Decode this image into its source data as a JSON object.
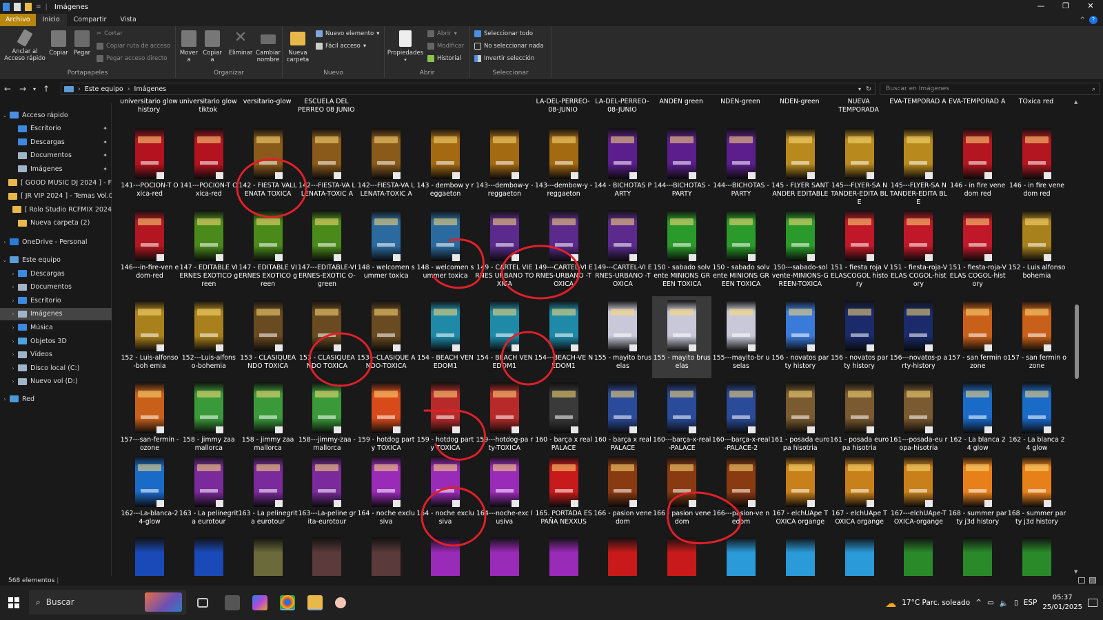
{
  "window": {
    "title": "Imágenes"
  },
  "menu_tabs": [
    "Archivo",
    "Inicio",
    "Compartir",
    "Vista"
  ],
  "ribbon": {
    "portapapeles": {
      "label": "Portapapeles",
      "pin": "Anclar al Acceso rápido",
      "copy": "Copiar",
      "paste": "Pegar",
      "cut": "Cortar",
      "copy_path": "Copiar ruta de acceso",
      "paste_shortcut": "Pegar acceso directo"
    },
    "organizar": {
      "label": "Organizar",
      "move": "Mover a",
      "copy_to": "Copiar a",
      "delete": "Eliminar",
      "rename": "Cambiar nombre"
    },
    "nuevo": {
      "label": "Nuevo",
      "new_folder": "Nueva carpeta",
      "new_item": "Nuevo elemento",
      "easy_access": "Fácil acceso"
    },
    "abrir": {
      "label": "Abrir",
      "properties": "Propiedades",
      "open": "Abrir",
      "edit": "Modificar",
      "history": "Historial"
    },
    "seleccionar": {
      "label": "Seleccionar",
      "select_all": "Seleccionar todo",
      "select_none": "No seleccionar nada",
      "invert": "Invertir selección"
    }
  },
  "address": {
    "root": "Este equipo",
    "sep": "›",
    "current": "Imágenes",
    "search_placeholder": "Buscar en Imágenes"
  },
  "nav": {
    "quick_access": "Acceso rápido",
    "quick_items": [
      {
        "label": "Escritorio",
        "icon": "desktop-icon",
        "color": "#3c8ae0",
        "pinned": true
      },
      {
        "label": "Descargas",
        "icon": "downloads-icon",
        "color": "#3c8ae0",
        "pinned": true
      },
      {
        "label": "Documentos",
        "icon": "documents-icon",
        "color": "#9fb4c8",
        "pinned": true
      },
      {
        "label": "Imágenes",
        "icon": "pictures-icon",
        "color": "#9fb4c8",
        "pinned": true
      },
      {
        "label": "[ GOOD MUSIC DJ 2024 ] - F",
        "icon": "folder-icon",
        "color": "#e8b84a",
        "pinned": false
      },
      {
        "label": "[ JR VIP 2024 ] - Temas Vol.0",
        "icon": "folder-icon",
        "color": "#e8b84a",
        "pinned": false
      },
      {
        "label": "[ Rolo Studio RCFMIX 2024",
        "icon": "folder-icon",
        "color": "#e8b84a",
        "pinned": false
      },
      {
        "label": "Nueva carpeta (2)",
        "icon": "folder-icon",
        "color": "#e8b84a",
        "pinned": false
      }
    ],
    "onedrive": "OneDrive - Personal",
    "this_pc": "Este equipo",
    "pc_items": [
      {
        "label": "Descargas",
        "icon": "downloads-icon",
        "color": "#3c8ae0"
      },
      {
        "label": "Documentos",
        "icon": "documents-icon",
        "color": "#9fb4c8"
      },
      {
        "label": "Escritorio",
        "icon": "desktop-icon",
        "color": "#3c8ae0"
      },
      {
        "label": "Imágenes",
        "icon": "pictures-icon",
        "color": "#9fb4c8"
      },
      {
        "label": "Música",
        "icon": "music-icon",
        "color": "#3c8ae0"
      },
      {
        "label": "Objetos 3D",
        "icon": "3d-objects-icon",
        "color": "#4aa3df"
      },
      {
        "label": "Vídeos",
        "icon": "videos-icon",
        "color": "#9fb4c8"
      },
      {
        "label": "Disco local (C:)",
        "icon": "drive-icon",
        "color": "#9fb4c8"
      },
      {
        "label": "Nuevo vol (D:)",
        "icon": "drive-icon",
        "color": "#9fb4c8"
      }
    ],
    "network": "Red"
  },
  "top_partial_names": [
    "universitario glow history",
    "universitario glow tiktok",
    "versitario-glow",
    "ESCUELA DEL PERREO 08 JUNIO",
    "",
    "",
    "",
    "LA-DEL-PERREO-08-JUNIO",
    "LA-DEL-PERREO-08-JUNIO",
    "ANDEN green",
    "NDEN-green",
    "NDEN-green",
    "NUEVA TEMPORADA",
    "EVA-TEMPORAD A",
    "EVA-TEMPORAD A",
    "TOxica red"
  ],
  "rows": [
    {
      "files": [
        {
          "name": "141---POCION-T Oxica-red",
          "color": "#b3121f"
        },
        {
          "name": "141---POCION-T Oxica-red",
          "color": "#b3121f"
        },
        {
          "name": "142 - FIESTA VALLENATA TOXICA",
          "color": "#8a5a1a"
        },
        {
          "name": "142---FIESTA-VA LLENATA-TOXIC A",
          "color": "#8a5a1a"
        },
        {
          "name": "142---FIESTA-VA LLENATA-TOXIC A",
          "color": "#8a5a1a"
        },
        {
          "name": "143 - dembow y reggaeton",
          "color": "#a36a12"
        },
        {
          "name": "143---dembow-y -reggaeton",
          "color": "#a36a12"
        },
        {
          "name": "143---dembow-y -reggaeton",
          "color": "#a36a12"
        },
        {
          "name": "144 - BICHOTAS PARTY",
          "color": "#5b1e8c"
        },
        {
          "name": "144---BICHOTAS -PARTY",
          "color": "#5b1e8c"
        },
        {
          "name": "144---BICHOTAS -PARTY",
          "color": "#5b1e8c"
        },
        {
          "name": "145 - FLYER SANTANDER EDITABLE",
          "color": "#b88a1e"
        },
        {
          "name": "145---FLYER-SA NTANDER-EDITA BLE",
          "color": "#b88a1e"
        },
        {
          "name": "145---FLYER-SA NTANDER-EDITA BLE",
          "color": "#b88a1e"
        },
        {
          "name": "146 - in fire venedom red",
          "color": "#b31620"
        },
        {
          "name": "146 - in fire venedom red",
          "color": "#b31620"
        }
      ]
    },
    {
      "files": [
        {
          "name": "146---in-fire-ven edom-red",
          "color": "#b31620"
        },
        {
          "name": "147 - EDITABLE VIERNES EXOTICO green",
          "color": "#4a8a1a"
        },
        {
          "name": "147 - EDITABLE VIERNES EXOTICO green",
          "color": "#4a8a1a"
        },
        {
          "name": "147---EDITABLE-VIERNES-EXOTIC O-green",
          "color": "#4a8a1a"
        },
        {
          "name": "148 - welcomen summer toxica",
          "color": "#2b6a9e"
        },
        {
          "name": "148 - welcomen summer toxica",
          "color": "#2b6a9e"
        },
        {
          "name": "149 - CARTEL VIERNES URBANO TOXICA",
          "color": "#5b2a8c"
        },
        {
          "name": "149---CARTEL-VI ERNES-URBANO -TOXICA",
          "color": "#5b2a8c"
        },
        {
          "name": "149---CARTEL-VI ERNES-URBANO -TOXICA",
          "color": "#5b2a8c"
        },
        {
          "name": "150 - sabado solvente MINIONS GREEN TOXICA",
          "color": "#2a9a2a"
        },
        {
          "name": "150 - sabado solvente MINIONS GREEN TOXICA",
          "color": "#2a9a2a"
        },
        {
          "name": "150---sabado-sol vente-MINIONS-GREEN-TOXICA",
          "color": "#2a9a2a"
        },
        {
          "name": "151 - fiesta roja VELASCOGOL history",
          "color": "#c01828"
        },
        {
          "name": "151 - fiesta-roja-VELAS COGOL-history",
          "color": "#c01828"
        },
        {
          "name": "151 - fiesta-roja-VELAS COGOL-history",
          "color": "#c01828"
        },
        {
          "name": "152 - Luis alfonso bohemia",
          "color": "#a8801c"
        }
      ]
    },
    {
      "files": [
        {
          "name": "152 - Luis-alfonso-boh emia",
          "color": "#a8801c"
        },
        {
          "name": "152---Luis-alfons o-bohemia",
          "color": "#a8801c"
        },
        {
          "name": "153 - CLASIQUEANDO TOXICA",
          "color": "#6a4a20"
        },
        {
          "name": "153 - CLASIQUEANDO TOXICA",
          "color": "#6a4a20"
        },
        {
          "name": "153---CLASIQUE ANDO-TOXICA",
          "color": "#6a4a20"
        },
        {
          "name": "154 - BEACH VENEDOM1",
          "color": "#1e8aa8"
        },
        {
          "name": "154 - BEACH VENEDOM1",
          "color": "#1e8aa8"
        },
        {
          "name": "154---BEACH-VE NEDOM1",
          "color": "#1e8aa8"
        },
        {
          "name": "155 - mayito bruselas",
          "color": "#c8c8d8"
        },
        {
          "name": "155 - mayito bruselas",
          "color": "#c8c8d8",
          "selected": true
        },
        {
          "name": "155---mayito-br uselas",
          "color": "#c8c8d8"
        },
        {
          "name": "156 - novatos party history",
          "color": "#3a7ad8"
        },
        {
          "name": "156 - novatos party history",
          "color": "#1a2a6a"
        },
        {
          "name": "156---novatos-p arty-history",
          "color": "#1a2a6a"
        },
        {
          "name": "157 - san fermin ozone",
          "color": "#c8601a"
        },
        {
          "name": "157 - san fermin ozone",
          "color": "#c8601a"
        }
      ]
    },
    {
      "files": [
        {
          "name": "157---san-fermin -ozone",
          "color": "#c8601a"
        },
        {
          "name": "158 - jimmy zaa mallorca",
          "color": "#3a9a3a"
        },
        {
          "name": "158 - jimmy zaa mallorca",
          "color": "#3a9a3a"
        },
        {
          "name": "158---jimmy-zaa -mallorca",
          "color": "#3a9a3a"
        },
        {
          "name": "159 - hotdog party TOXICA",
          "color": "#d84a1a"
        },
        {
          "name": "159 - hotdog party TOXICA",
          "color": "#b82a2a"
        },
        {
          "name": "159---hotdog-pa rty-TOXICA",
          "color": "#b82a2a"
        },
        {
          "name": "160 - barça x real PALACE",
          "color": "#3a3a3a"
        },
        {
          "name": "160 - barça x real PALACE",
          "color": "#2a4a9a"
        },
        {
          "name": "160---barça-x-real-PALACE",
          "color": "#2a4a9a"
        },
        {
          "name": "160---barça-x-real-PALACE-2",
          "color": "#2a4a9a"
        },
        {
          "name": "161 - posada europa hisotria",
          "color": "#7a5a30"
        },
        {
          "name": "161 - posada europa hisotria",
          "color": "#7a5a30"
        },
        {
          "name": "161---posada-eu ropa-hisotria",
          "color": "#7a5a30"
        },
        {
          "name": "162 - La blanca 24 glow",
          "color": "#1a6ac8"
        },
        {
          "name": "162 - La blanca 24 glow",
          "color": "#1a6ac8"
        }
      ]
    },
    {
      "files": [
        {
          "name": "162---La-blanca-24-glow",
          "color": "#1a6ac8"
        },
        {
          "name": "163 - La pelinegrita eurotour",
          "color": "#7a2a9a"
        },
        {
          "name": "163 - La pelinegrita eurotour",
          "color": "#7a2a9a"
        },
        {
          "name": "163---La-peline grita-eurotour",
          "color": "#7a2a9a"
        },
        {
          "name": "164 - noche exclusiva",
          "color": "#9a2ab8"
        },
        {
          "name": "164 - noche exclusiva",
          "color": "#9a2ab8"
        },
        {
          "name": "164---noche-exc lusiva",
          "color": "#9a2ab8"
        },
        {
          "name": "165. PORTADA ESPAÑA NEXXUS",
          "color": "#c81a1a"
        },
        {
          "name": "166 - pasion venedom",
          "color": "#8a3a10"
        },
        {
          "name": "166 - pasion venedom",
          "color": "#8a3a10"
        },
        {
          "name": "166---pasion-ve nedom",
          "color": "#8a3a10"
        },
        {
          "name": "167 - elchUApe TOXICA organge",
          "color": "#c8801a"
        },
        {
          "name": "167 - elchUApe TOXICA organge",
          "color": "#c8801a"
        },
        {
          "name": "167---elchUApe-TOXICA-organge",
          "color": "#c8801a"
        },
        {
          "name": "168 - summer party j3d history",
          "color": "#e8801a"
        },
        {
          "name": "168 - summer party j3d history",
          "color": "#e8801a"
        }
      ]
    }
  ],
  "bottom_thumb_colors": [
    "#1a4ab8",
    "#1a4ab8",
    "#6a6a3a",
    "#5a3a3a",
    "#5a3a3a",
    "#9a2ab8",
    "#9a2ab8",
    "#9a2ab8",
    "#c81a1a",
    "#c81a1a",
    "#2a9ad8",
    "#2a9ad8",
    "#2a9ad8",
    "#2a8a2a",
    "#2a8a2a",
    "#2a8a2a"
  ],
  "status": {
    "count": "568 elementos"
  },
  "taskbar": {
    "search": "Buscar",
    "weather": "17°C Parc. soleado",
    "lang": "ESP",
    "time": "05:37",
    "date": "25/01/2025"
  }
}
